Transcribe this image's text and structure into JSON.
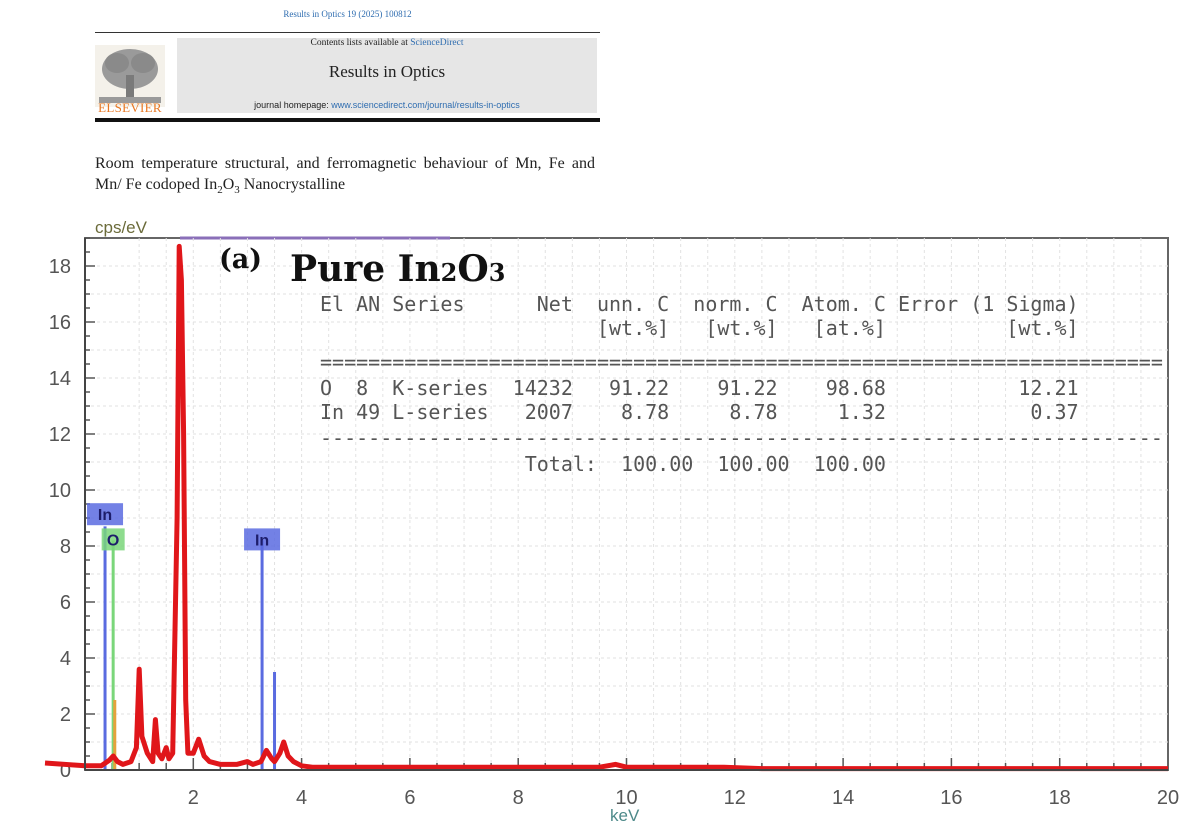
{
  "header": {
    "journal_ref": "Results in Optics 19 (2025) 100812",
    "publisher": "ELSEVIER",
    "contents_prefix": "Contents lists available at ",
    "contents_link": "ScienceDirect",
    "journal_name": "Results in Optics",
    "homepage_prefix": "journal homepage: ",
    "homepage_url": "www.sciencedirect.com/journal/results-in-optics"
  },
  "paper": {
    "title_part1": "Room temperature structural, and ferromagnetic behaviour of Mn, Fe and Mn/ Fe codoped In",
    "title_sub1": "2",
    "title_part2": "O",
    "title_sub2": "3",
    "title_part3": " Nanocrystalline"
  },
  "chart_data": {
    "type": "line",
    "panel_label": "(a)",
    "title_parts": [
      "Pure In",
      "2",
      "O",
      "3"
    ],
    "ylabel": "cps/eV",
    "xlabel": "keV",
    "xlim": [
      0,
      20
    ],
    "ylim": [
      0,
      19
    ],
    "x_ticks": [
      2,
      4,
      6,
      8,
      10,
      12,
      14,
      16,
      18,
      20
    ],
    "y_ticks": [
      0,
      2,
      4,
      6,
      8,
      10,
      12,
      14,
      16,
      18
    ],
    "grid": true,
    "series": [
      {
        "color": "#e0161a",
        "x": [
          -0.8,
          0.0,
          0.3,
          0.45,
          0.52,
          0.6,
          0.7,
          0.85,
          0.95,
          1.0,
          1.05,
          1.15,
          1.25,
          1.3,
          1.35,
          1.42,
          1.5,
          1.55,
          1.62,
          1.7,
          1.74,
          1.78,
          1.82,
          1.86,
          1.9,
          2.0,
          2.1,
          2.2,
          2.3,
          2.5,
          2.8,
          3.0,
          3.1,
          3.25,
          3.35,
          3.45,
          3.5,
          3.6,
          3.67,
          3.75,
          3.85,
          4.0,
          4.2,
          5.0,
          6.0,
          8.0,
          9.5,
          9.8,
          10.0,
          10.3,
          11.0,
          11.8,
          12.5,
          14.0,
          16.0,
          18.0,
          20.0
        ],
        "y": [
          0.25,
          0.15,
          0.15,
          0.35,
          0.5,
          0.3,
          0.2,
          0.3,
          0.8,
          3.6,
          1.2,
          0.6,
          0.3,
          1.8,
          0.6,
          0.4,
          0.8,
          0.4,
          0.6,
          9.0,
          18.7,
          17.5,
          12.0,
          2.5,
          0.6,
          0.6,
          1.1,
          0.5,
          0.3,
          0.2,
          0.2,
          0.3,
          0.2,
          0.3,
          0.7,
          0.4,
          0.3,
          0.6,
          1.0,
          0.5,
          0.3,
          0.15,
          0.1,
          0.1,
          0.1,
          0.1,
          0.1,
          0.2,
          0.1,
          0.1,
          0.1,
          0.1,
          0.05,
          0.05,
          0.05,
          0.05,
          0.05
        ]
      }
    ],
    "element_markers": [
      {
        "label": "In",
        "x": 0.37,
        "height": 8.7,
        "color": "#5a6be0",
        "label_y": 9.1
      },
      {
        "label": "O",
        "x": 0.52,
        "height": 8.2,
        "color": "#7ad67a",
        "label_y": 8.2
      },
      {
        "label": "In",
        "x": 3.27,
        "height": 8.2,
        "color": "#5a6be0",
        "label_y": 8.2
      }
    ],
    "table": {
      "header1": [
        "El",
        "AN",
        "Series",
        "Net",
        "unn. C",
        "norm. C",
        "Atom. C",
        "Error (1 Sigma)"
      ],
      "header2": [
        "",
        "",
        "",
        "",
        "[wt.%]",
        "[wt.%]",
        "[at.%]",
        "[wt.%]"
      ],
      "rows": [
        [
          "O",
          "8",
          "K-series",
          "14232",
          "91.22",
          "91.22",
          "98.68",
          "12.21"
        ],
        [
          "In",
          "49",
          "L-series",
          "2007",
          "8.78",
          "8.78",
          "1.32",
          "0.37"
        ]
      ],
      "total_label": "Total:",
      "totals": [
        "100.00",
        "100.00",
        "100.00"
      ]
    }
  }
}
